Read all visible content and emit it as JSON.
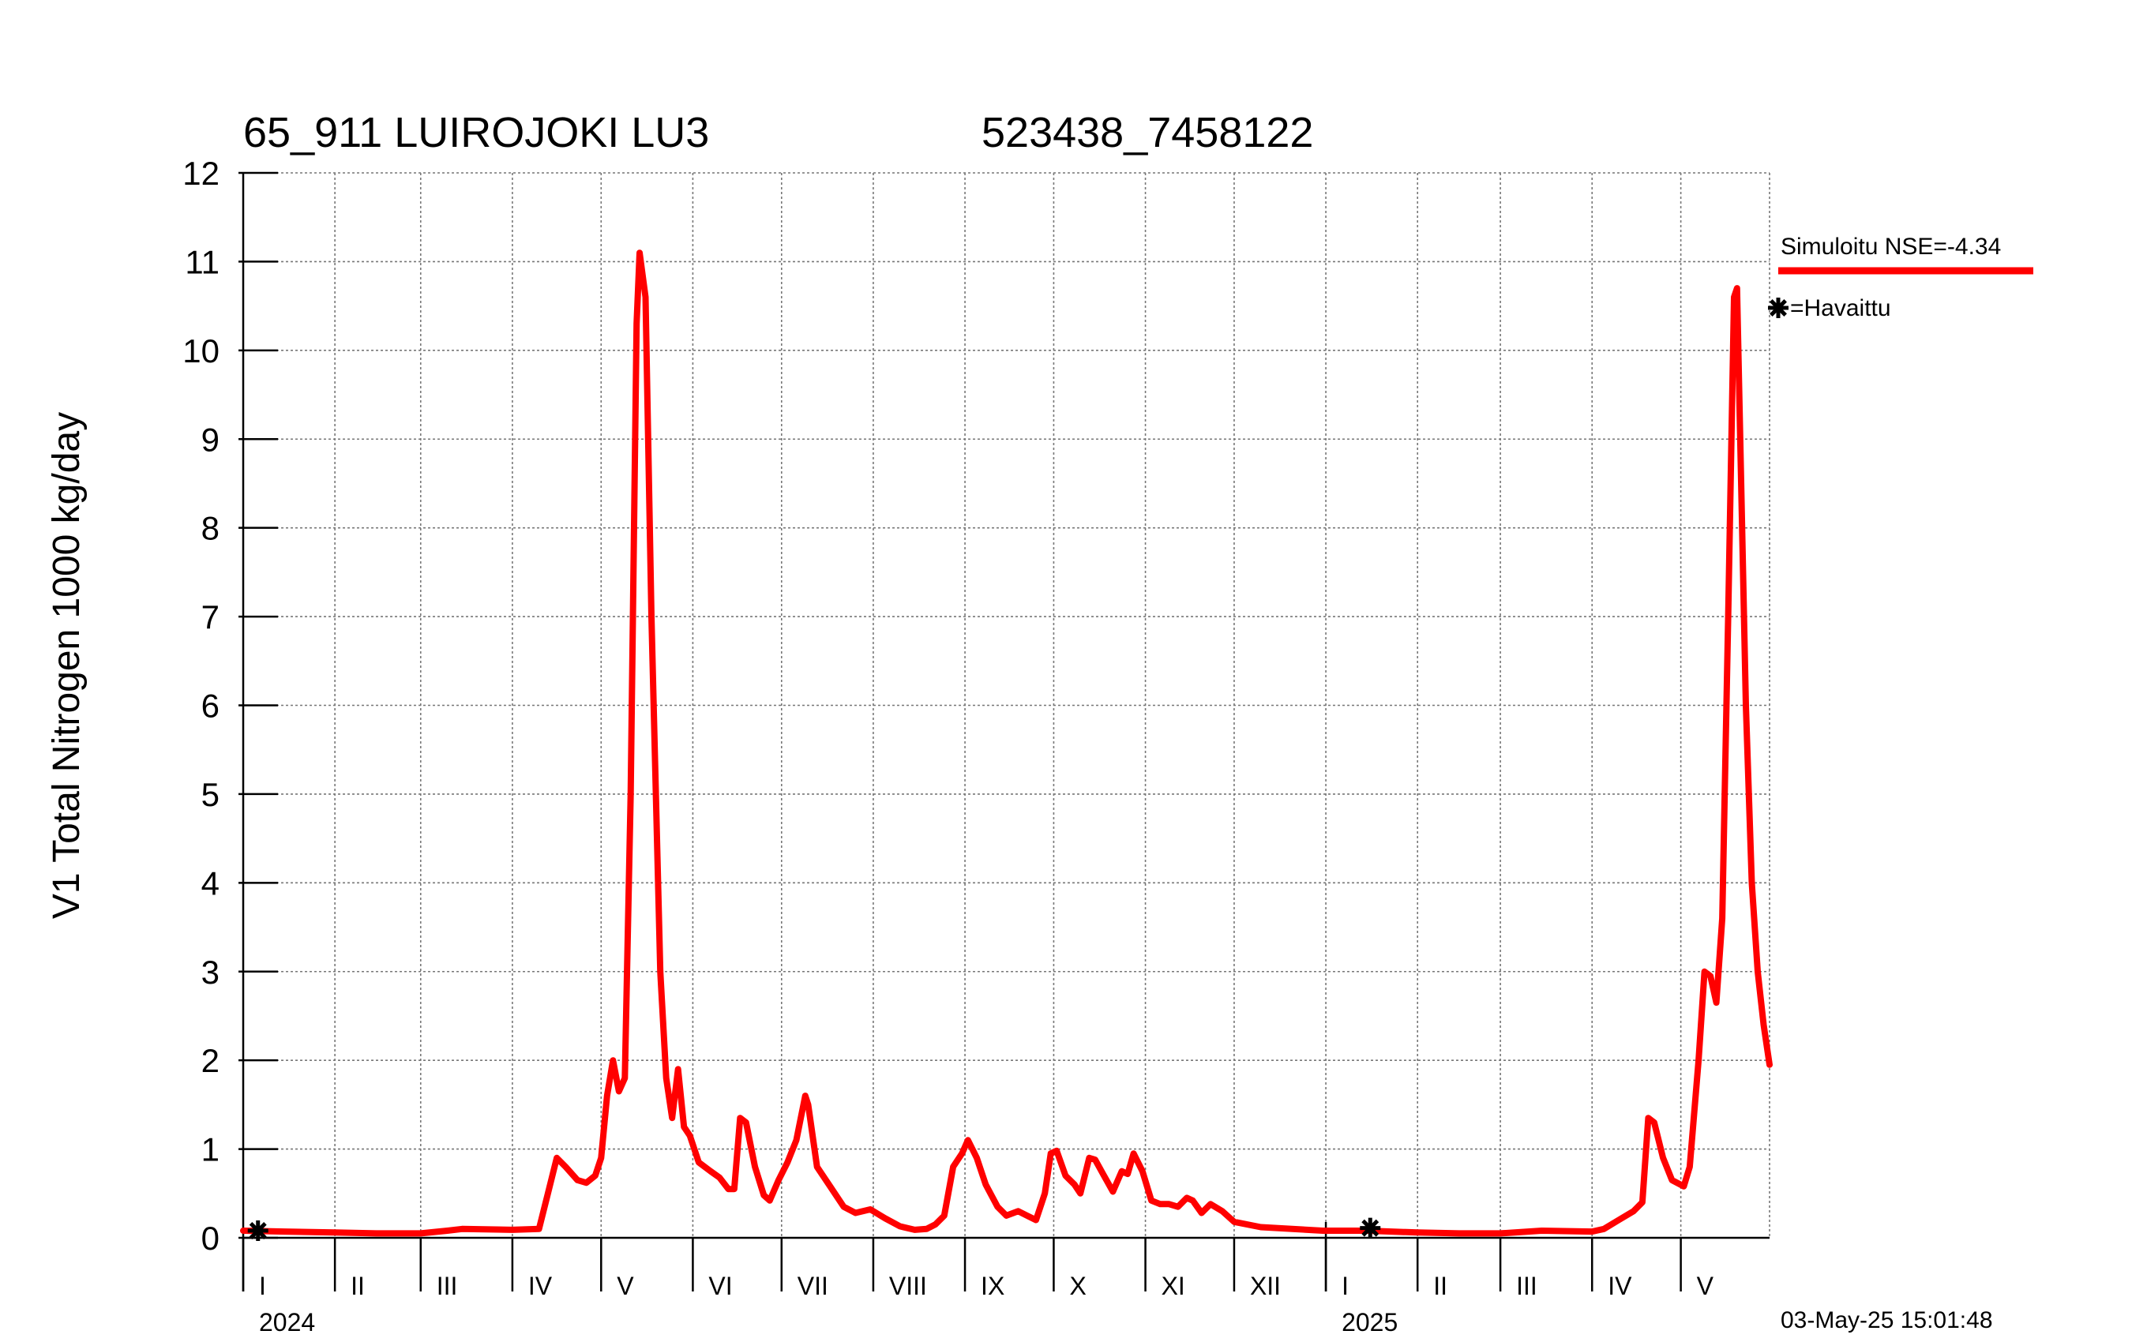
{
  "title_left": "65_911 LUIROJOKI LU3",
  "title_right": "523438_7458122",
  "ylabel": "V1 Total Nitrogen 1000 kg/day",
  "timestamp": "03-May-25 15:01:48",
  "legend": {
    "simulated_label": "Simuloitu NSE=-4.34",
    "observed_label": "=Havaittu"
  },
  "colors": {
    "simulated": "#ff0000",
    "observed": "#000000",
    "grid": "#777777"
  },
  "chart_data": {
    "type": "line",
    "title": "65_911 LUIROJOKI LU3   523438_7458122",
    "ylabel": "V1 Total Nitrogen 1000 kg/day",
    "ylim": [
      0,
      12
    ],
    "yticks": [
      "0",
      "1",
      "2",
      "3",
      "4",
      "5",
      "6",
      "7",
      "8",
      "9",
      "10",
      "11",
      "12"
    ],
    "xlim": [
      "2024-01-01",
      "2025-05-31"
    ],
    "grid": true,
    "legend_position": "top-right",
    "months": [
      {
        "label": "I",
        "start": "2024-01-01"
      },
      {
        "label": "II",
        "start": "2024-02-01"
      },
      {
        "label": "III",
        "start": "2024-03-01"
      },
      {
        "label": "IV",
        "start": "2024-04-01"
      },
      {
        "label": "V",
        "start": "2024-05-01"
      },
      {
        "label": "VI",
        "start": "2024-06-01"
      },
      {
        "label": "VII",
        "start": "2024-07-01"
      },
      {
        "label": "VIII",
        "start": "2024-08-01"
      },
      {
        "label": "IX",
        "start": "2024-09-01"
      },
      {
        "label": "X",
        "start": "2024-10-01"
      },
      {
        "label": "XI",
        "start": "2024-11-01"
      },
      {
        "label": "XII",
        "start": "2024-12-01"
      },
      {
        "label": "I",
        "start": "2025-01-01"
      },
      {
        "label": "II",
        "start": "2025-02-01"
      },
      {
        "label": "III",
        "start": "2025-03-01"
      },
      {
        "label": "IV",
        "start": "2025-04-01"
      },
      {
        "label": "V",
        "start": "2025-05-01"
      }
    ],
    "years": [
      {
        "label": "2024",
        "start": "2024-01-01"
      },
      {
        "label": "2025",
        "start": "2025-01-01"
      }
    ],
    "series": [
      {
        "name": "Simuloitu NSE=-4.34",
        "style": "line",
        "points": [
          [
            "2024-01-01",
            0.08
          ],
          [
            "2024-01-15",
            0.07
          ],
          [
            "2024-02-01",
            0.06
          ],
          [
            "2024-02-15",
            0.05
          ],
          [
            "2024-03-01",
            0.05
          ],
          [
            "2024-03-10",
            0.08
          ],
          [
            "2024-03-15",
            0.1
          ],
          [
            "2024-04-01",
            0.09
          ],
          [
            "2024-04-10",
            0.1
          ],
          [
            "2024-04-13",
            0.5
          ],
          [
            "2024-04-16",
            0.9
          ],
          [
            "2024-04-19",
            0.8
          ],
          [
            "2024-04-23",
            0.65
          ],
          [
            "2024-04-26",
            0.62
          ],
          [
            "2024-04-29",
            0.7
          ],
          [
            "2024-05-01",
            0.9
          ],
          [
            "2024-05-03",
            1.6
          ],
          [
            "2024-05-05",
            2.0
          ],
          [
            "2024-05-07",
            1.65
          ],
          [
            "2024-05-09",
            1.8
          ],
          [
            "2024-05-11",
            5.0
          ],
          [
            "2024-05-13",
            10.3
          ],
          [
            "2024-05-14",
            11.1
          ],
          [
            "2024-05-16",
            10.6
          ],
          [
            "2024-05-18",
            7.0
          ],
          [
            "2024-05-21",
            3.0
          ],
          [
            "2024-05-23",
            1.8
          ],
          [
            "2024-05-25",
            1.35
          ],
          [
            "2024-05-27",
            1.9
          ],
          [
            "2024-05-29",
            1.25
          ],
          [
            "2024-05-31",
            1.15
          ],
          [
            "2024-06-03",
            0.85
          ],
          [
            "2024-06-07",
            0.75
          ],
          [
            "2024-06-10",
            0.68
          ],
          [
            "2024-06-13",
            0.55
          ],
          [
            "2024-06-15",
            0.55
          ],
          [
            "2024-06-17",
            1.35
          ],
          [
            "2024-06-19",
            1.3
          ],
          [
            "2024-06-22",
            0.8
          ],
          [
            "2024-06-25",
            0.48
          ],
          [
            "2024-06-27",
            0.42
          ],
          [
            "2024-06-30",
            0.65
          ],
          [
            "2024-07-03",
            0.85
          ],
          [
            "2024-07-06",
            1.1
          ],
          [
            "2024-07-09",
            1.6
          ],
          [
            "2024-07-10",
            1.5
          ],
          [
            "2024-07-13",
            0.8
          ],
          [
            "2024-07-17",
            0.6
          ],
          [
            "2024-07-22",
            0.35
          ],
          [
            "2024-07-26",
            0.28
          ],
          [
            "2024-07-31",
            0.32
          ],
          [
            "2024-08-05",
            0.22
          ],
          [
            "2024-08-10",
            0.13
          ],
          [
            "2024-08-15",
            0.09
          ],
          [
            "2024-08-19",
            0.1
          ],
          [
            "2024-08-22",
            0.15
          ],
          [
            "2024-08-25",
            0.25
          ],
          [
            "2024-08-28",
            0.8
          ],
          [
            "2024-08-31",
            0.95
          ],
          [
            "2024-09-02",
            1.1
          ],
          [
            "2024-09-05",
            0.9
          ],
          [
            "2024-09-08",
            0.6
          ],
          [
            "2024-09-12",
            0.35
          ],
          [
            "2024-09-15",
            0.25
          ],
          [
            "2024-09-19",
            0.3
          ],
          [
            "2024-09-22",
            0.25
          ],
          [
            "2024-09-25",
            0.2
          ],
          [
            "2024-09-28",
            0.5
          ],
          [
            "2024-09-30",
            0.95
          ],
          [
            "2024-10-02",
            0.98
          ],
          [
            "2024-10-05",
            0.7
          ],
          [
            "2024-10-08",
            0.6
          ],
          [
            "2024-10-10",
            0.5
          ],
          [
            "2024-10-13",
            0.9
          ],
          [
            "2024-10-15",
            0.88
          ],
          [
            "2024-10-18",
            0.7
          ],
          [
            "2024-10-21",
            0.52
          ],
          [
            "2024-10-24",
            0.75
          ],
          [
            "2024-10-26",
            0.72
          ],
          [
            "2024-10-28",
            0.95
          ],
          [
            "2024-10-31",
            0.75
          ],
          [
            "2024-11-03",
            0.42
          ],
          [
            "2024-11-06",
            0.38
          ],
          [
            "2024-11-09",
            0.38
          ],
          [
            "2024-11-12",
            0.35
          ],
          [
            "2024-11-15",
            0.45
          ],
          [
            "2024-11-17",
            0.42
          ],
          [
            "2024-11-20",
            0.28
          ],
          [
            "2024-11-23",
            0.38
          ],
          [
            "2024-11-27",
            0.3
          ],
          [
            "2024-12-01",
            0.18
          ],
          [
            "2024-12-10",
            0.12
          ],
          [
            "2024-12-31",
            0.08
          ],
          [
            "2025-01-15",
            0.08
          ],
          [
            "2025-02-01",
            0.06
          ],
          [
            "2025-02-15",
            0.05
          ],
          [
            "2025-03-01",
            0.05
          ],
          [
            "2025-03-15",
            0.08
          ],
          [
            "2025-04-01",
            0.07
          ],
          [
            "2025-04-05",
            0.1
          ],
          [
            "2025-04-10",
            0.2
          ],
          [
            "2025-04-15",
            0.3
          ],
          [
            "2025-04-18",
            0.4
          ],
          [
            "2025-04-20",
            1.35
          ],
          [
            "2025-04-22",
            1.3
          ],
          [
            "2025-04-25",
            0.9
          ],
          [
            "2025-04-28",
            0.65
          ],
          [
            "2025-05-02",
            0.58
          ],
          [
            "2025-05-04",
            0.8
          ],
          [
            "2025-05-07",
            2.0
          ],
          [
            "2025-05-09",
            3.0
          ],
          [
            "2025-05-11",
            2.95
          ],
          [
            "2025-05-13",
            2.65
          ],
          [
            "2025-05-15",
            3.6
          ],
          [
            "2025-05-17",
            7.0
          ],
          [
            "2025-05-19",
            10.6
          ],
          [
            "2025-05-20",
            10.7
          ],
          [
            "2025-05-23",
            6.0
          ],
          [
            "2025-05-25",
            4.0
          ],
          [
            "2025-05-27",
            3.0
          ],
          [
            "2025-05-29",
            2.4
          ],
          [
            "2025-05-31",
            1.95
          ]
        ]
      },
      {
        "name": "Havaittu",
        "style": "marker",
        "points": [
          [
            "2024-01-06",
            0.08
          ],
          [
            "2025-01-16",
            0.11
          ]
        ]
      }
    ]
  }
}
